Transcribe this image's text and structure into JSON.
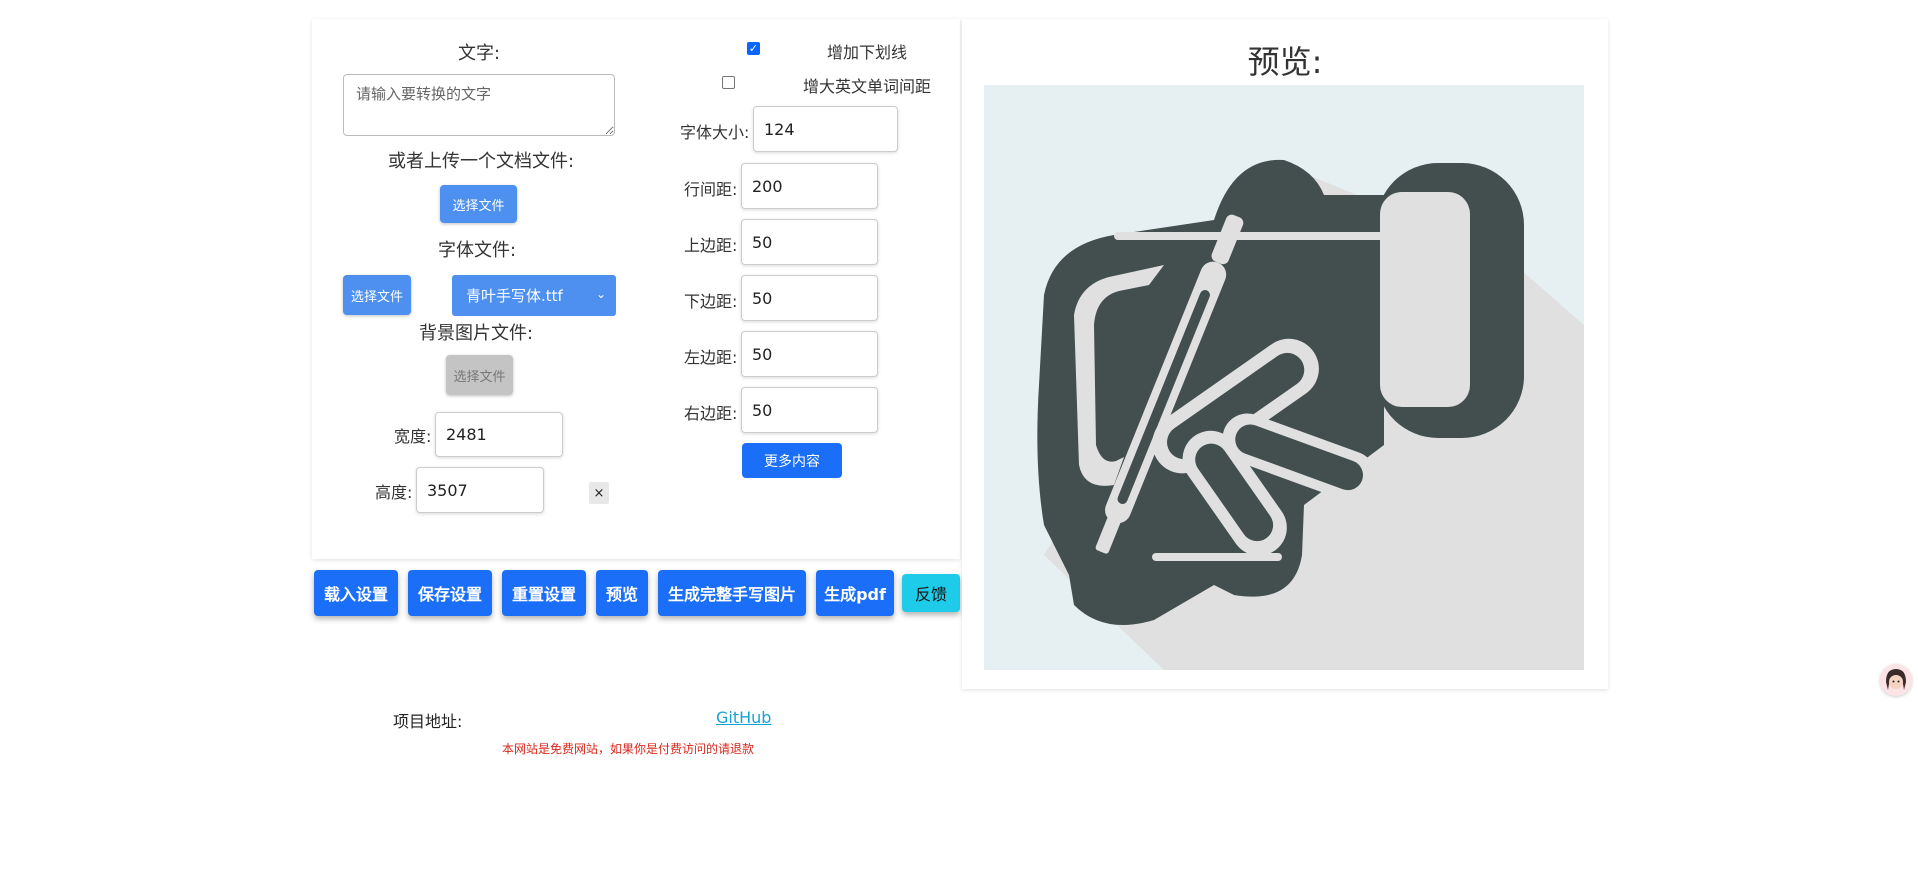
{
  "form": {
    "text_label": "文字:",
    "text_placeholder": "请输入要转换的文字",
    "upload_doc_label": "或者上传一个文档文件:",
    "choose_file": "选择文件",
    "font_file_label": "字体文件:",
    "font_select_value": "青叶手写体.ttf",
    "bg_image_label": "背景图片文件:",
    "width_label": "宽度:",
    "width_value": "2481",
    "height_label": "高度:",
    "height_value": "3507",
    "close_symbol": "×"
  },
  "options": {
    "underline_label": "增加下划线",
    "underline_checked": true,
    "word_spacing_label": "增大英文单词间距",
    "word_spacing_checked": false,
    "font_size_label": "字体大小:",
    "font_size_value": "124",
    "line_spacing_label": "行间距:",
    "line_spacing_value": "200",
    "top_margin_label": "上边距:",
    "top_margin_value": "50",
    "bottom_margin_label": "下边距:",
    "bottom_margin_value": "50",
    "left_margin_label": "左边距:",
    "left_margin_value": "50",
    "right_margin_label": "右边距:",
    "right_margin_value": "50",
    "more_button": "更多内容"
  },
  "actions": {
    "load_settings": "载入设置",
    "save_settings": "保存设置",
    "reset_settings": "重置设置",
    "preview": "预览",
    "generate_images": "生成完整手写图片",
    "generate_pdf": "生成pdf",
    "feedback": "反馈"
  },
  "preview": {
    "title": "预览:",
    "icon": "handwriting-hand-pen-icon",
    "icon_color": "#424f4e"
  },
  "footer": {
    "project_label": "项目地址:",
    "github_link": "GitHub",
    "notice": "本网站是免费网站，如果你是付费访问的请退款"
  },
  "colors": {
    "primary": "#1a6ef7",
    "file_button": "#4d90f0",
    "feedback": "#1ecbe8",
    "notice": "#d9281d",
    "link": "#17a2d6"
  }
}
